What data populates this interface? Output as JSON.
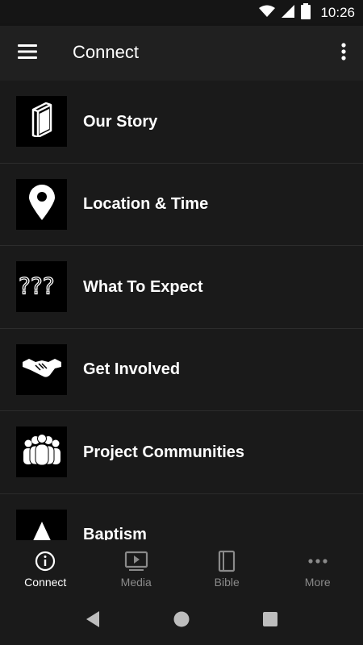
{
  "status_bar": {
    "time": "10:26"
  },
  "app_bar": {
    "title": "Connect"
  },
  "list": [
    {
      "label": "Our Story",
      "icon": "book-icon"
    },
    {
      "label": "Location & Time",
      "icon": "location-pin-icon"
    },
    {
      "label": "What To Expect",
      "icon": "question-marks-icon"
    },
    {
      "label": "Get Involved",
      "icon": "handshake-icon"
    },
    {
      "label": "Project Communities",
      "icon": "people-group-icon"
    },
    {
      "label": "Baptism",
      "icon": "triangle-icon"
    }
  ],
  "bottom_nav": [
    {
      "label": "Connect",
      "icon": "info-icon",
      "active": true
    },
    {
      "label": "Media",
      "icon": "video-play-icon",
      "active": false
    },
    {
      "label": "Bible",
      "icon": "bible-book-icon",
      "active": false
    },
    {
      "label": "More",
      "icon": "more-dots-icon",
      "active": false
    }
  ],
  "colors": {
    "background": "#1a1a1a",
    "app_bar": "#202020",
    "active": "#ffffff",
    "inactive": "#8a8a8a"
  }
}
